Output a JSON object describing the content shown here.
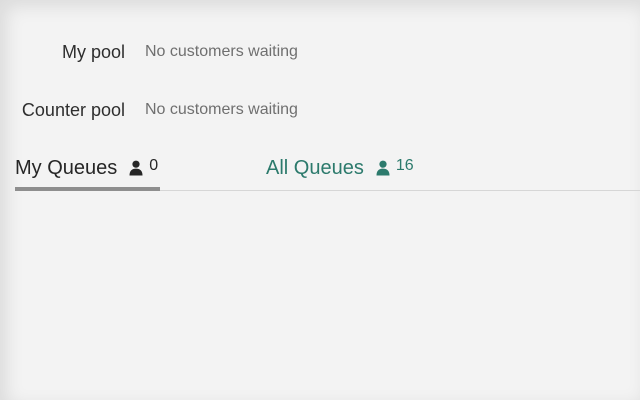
{
  "pools": [
    {
      "label": "My pool",
      "status": "No customers waiting"
    },
    {
      "label": "Counter pool",
      "status": "No customers waiting"
    }
  ],
  "tabs": [
    {
      "label": "My Queues",
      "count": "0",
      "icon": "person-icon",
      "active": true
    },
    {
      "label": "All Queues",
      "count": "16",
      "icon": "person-icon",
      "active": false
    }
  ],
  "colors": {
    "accent": "#2c7a6c",
    "text": "#262626",
    "muted": "#6f6f6f",
    "indicator": "#8e8e8e"
  }
}
